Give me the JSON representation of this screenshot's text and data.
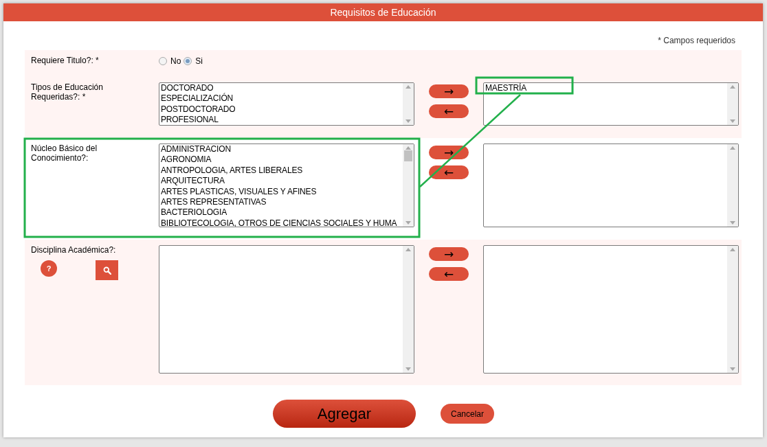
{
  "dialog": {
    "title": "Requisitos de Educación",
    "required_note": "* Campos requeridos"
  },
  "fields": [
    {
      "kind": "radio",
      "label": "Requiere Titulo?: *",
      "options": [
        {
          "label": "No",
          "selected": false
        },
        {
          "label": "Si",
          "selected": true
        }
      ]
    },
    {
      "kind": "transfer",
      "label": "Tipos de Educación Requeridas?: *",
      "available": [
        "DOCTORADO",
        "ESPECIALIZACIÓN",
        "POSTDOCTORADO",
        "PROFESIONAL"
      ],
      "chosen": [
        "MAESTRÍA"
      ],
      "add": "→",
      "remove": "←"
    },
    {
      "kind": "transfer",
      "label": "Núcleo Básico del Conocimiento?:",
      "available": [
        "ADMINISTRACION",
        "AGRONOMIA",
        "ANTROPOLOGIA, ARTES LIBERALES",
        "ARQUITECTURA",
        "ARTES PLASTICAS, VISUALES Y AFINES",
        "ARTES REPRESENTATIVAS",
        "BACTERIOLOGIA",
        "BIBLIOTECOLOGIA, OTROS DE CIENCIAS SOCIALES Y HUMA"
      ],
      "add": "→",
      "remove": "←"
    },
    {
      "kind": "transfer",
      "label": "Disciplina Académica?:",
      "help": "?",
      "add": "→",
      "remove": "←"
    }
  ],
  "buttons": [
    {
      "kind": "primary",
      "label": "Agregar"
    },
    {
      "kind": "secondary",
      "label": "Cancelar"
    }
  ]
}
